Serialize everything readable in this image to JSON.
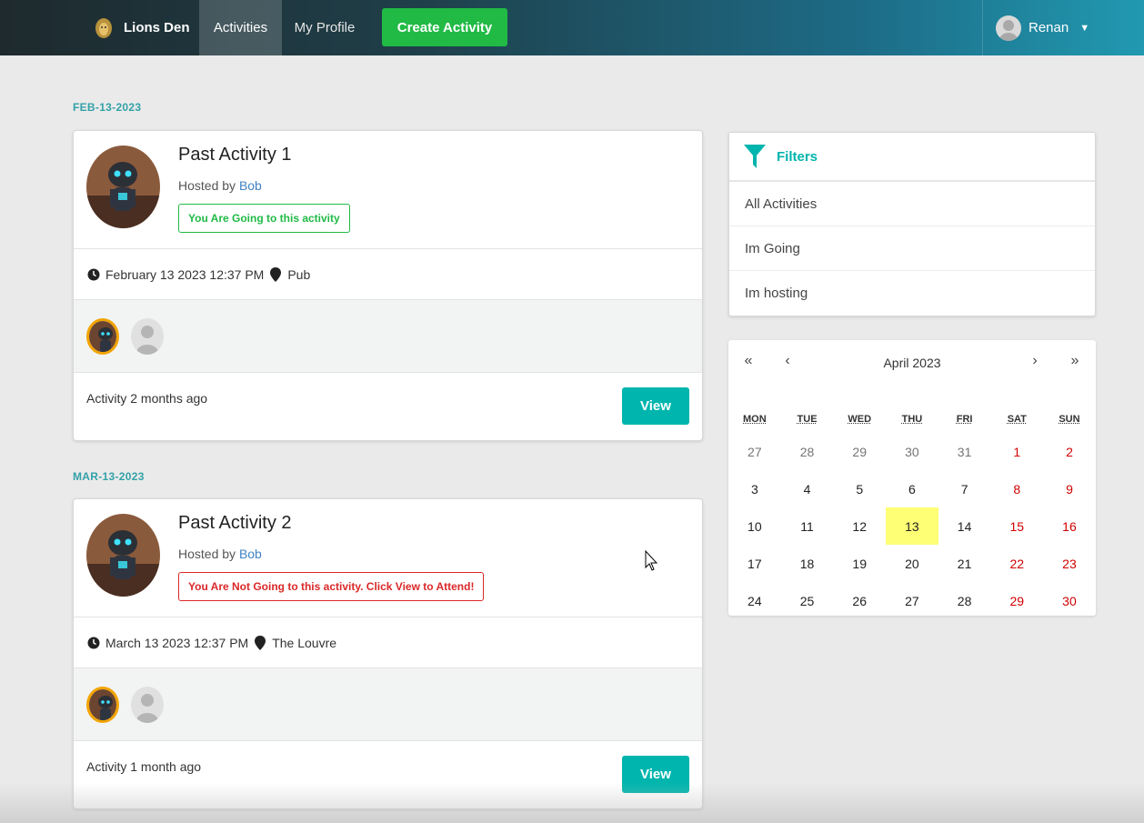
{
  "nav": {
    "brand": "Lions Den",
    "items": [
      {
        "label": "Activities"
      },
      {
        "label": "My Profile"
      }
    ],
    "create_label": "Create Activity",
    "user": "Renan"
  },
  "groups": [
    {
      "date": "FEB-13-2023",
      "activity": {
        "title": "Past Activity 1",
        "hosted_prefix": "Hosted by",
        "host": "Bob",
        "status": "You Are Going to this activity",
        "datetime": "February 13 2023 12:37 PM",
        "venue": "Pub",
        "footer": "Activity 2 months ago",
        "view_label": "View"
      }
    },
    {
      "date": "MAR-13-2023",
      "activity": {
        "title": "Past Activity 2",
        "hosted_prefix": "Hosted by",
        "host": "Bob",
        "status": "You Are Not Going to this activity. Click View to Attend!",
        "datetime": "March 13 2023 12:37 PM",
        "venue": "The Louvre",
        "footer": "Activity 1 month ago",
        "view_label": "View"
      }
    }
  ],
  "filters": {
    "title": "Filters",
    "items": [
      "All Activities",
      "Im Going",
      "Im hosting"
    ]
  },
  "calendar": {
    "month_label": "April 2023",
    "nav": {
      "prev_year": "«",
      "prev": "‹",
      "next": "›",
      "next_year": "»"
    },
    "weekdays": [
      "MON",
      "TUE",
      "WED",
      "THU",
      "FRI",
      "SAT",
      "SUN"
    ],
    "weeks": [
      [
        "27",
        "28",
        "29",
        "30",
        "31",
        "1",
        "2"
      ],
      [
        "3",
        "4",
        "5",
        "6",
        "7",
        "8",
        "9"
      ],
      [
        "10",
        "11",
        "12",
        "13",
        "14",
        "15",
        "16"
      ],
      [
        "17",
        "18",
        "19",
        "20",
        "21",
        "22",
        "23"
      ],
      [
        "24",
        "25",
        "26",
        "27",
        "28",
        "29",
        "30"
      ]
    ],
    "selected": "13"
  },
  "colors": {
    "accent": "#00b5ad",
    "green": "#21ba45",
    "red": "#db2828",
    "highlight": "#ffff76"
  }
}
